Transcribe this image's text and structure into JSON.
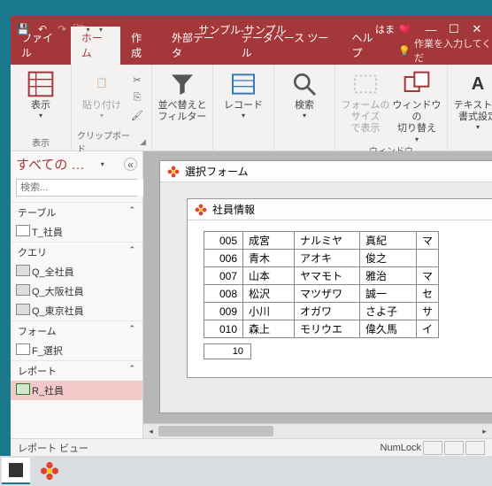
{
  "titlebar": {
    "app_title": "サンプル-サンプル",
    "username": "はま"
  },
  "tabs": {
    "file": "ファイル",
    "home": "ホーム",
    "create": "作成",
    "ext_data": "外部データ",
    "db_tools": "データベース ツール",
    "help": "ヘルプ",
    "tellme": "作業を入力してくだ"
  },
  "ribbon": {
    "view": {
      "label": "表示",
      "group": "表示"
    },
    "clipboard": {
      "paste": "貼り付け",
      "group": "クリップボード"
    },
    "sort": {
      "label": "並べ替えと\nフィルター"
    },
    "records": {
      "label": "レコード"
    },
    "find": {
      "label": "検索"
    },
    "form_size": {
      "label": "フォームのサイズ\nで表示"
    },
    "switch_win": {
      "label": "ウィンドウの\n切り替え"
    },
    "window_group": "ウィンドウ",
    "text_fmt": {
      "label": "テキストの\n書式設定"
    }
  },
  "nav": {
    "title": "すべての …",
    "search_placeholder": "検索...",
    "groups": {
      "tables": "テーブル",
      "queries": "クエリ",
      "forms": "フォーム",
      "reports": "レポート"
    },
    "items": {
      "t_emp": "T_社員",
      "q_all": "Q_全社員",
      "q_osaka": "Q_大阪社員",
      "q_tokyo": "Q_東京社員",
      "f_sel": "F_選択",
      "r_emp": "R_社員"
    }
  },
  "form": {
    "title": "選択フォーム"
  },
  "subform": {
    "title": "社員情報",
    "nav_record": "10",
    "rows": [
      {
        "id": "005",
        "c1": "成宮",
        "c2": "ナルミヤ",
        "c3": "真紀",
        "c4": "マ"
      },
      {
        "id": "006",
        "c1": "青木",
        "c2": "アオキ",
        "c3": "俊之",
        "c4": ""
      },
      {
        "id": "007",
        "c1": "山本",
        "c2": "ヤマモト",
        "c3": "雅治",
        "c4": "マ"
      },
      {
        "id": "008",
        "c1": "松沢",
        "c2": "マツザワ",
        "c3": "誠一",
        "c4": "セ"
      },
      {
        "id": "009",
        "c1": "小川",
        "c2": "オガワ",
        "c3": "さよ子",
        "c4": "サ"
      },
      {
        "id": "010",
        "c1": "森上",
        "c2": "モリウエ",
        "c3": "偉久馬",
        "c4": "イ"
      }
    ]
  },
  "status": {
    "view": "レポート ビュー",
    "numlock": "NumLock"
  }
}
